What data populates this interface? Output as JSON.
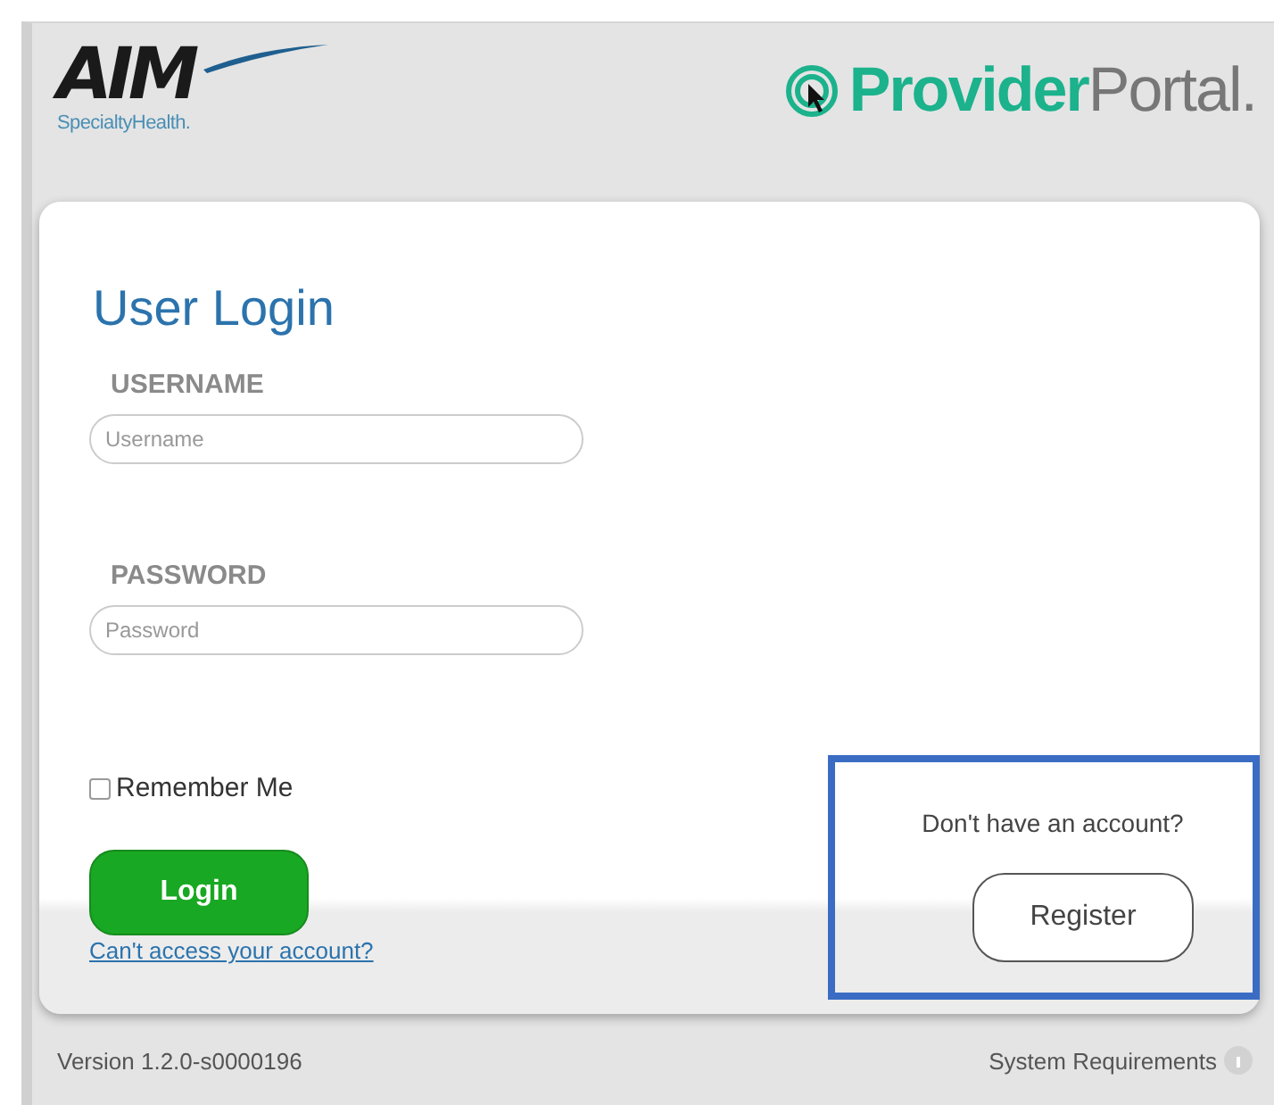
{
  "header": {
    "brand_logo": {
      "mark": "AIM",
      "tagline": "SpecialtyHealth."
    },
    "portal_logo": {
      "strong": "Provider",
      "light": "Portal."
    }
  },
  "login": {
    "title": "User Login",
    "fields": [
      {
        "label": "USERNAME",
        "placeholder": "Username"
      },
      {
        "label": "PASSWORD",
        "placeholder": "Password"
      }
    ],
    "remember": {
      "label": "Remember Me",
      "checked": false
    },
    "login_button": "Login",
    "help_link": "Can't access your account?"
  },
  "register_box": {
    "prompt": "Don't have an account?",
    "button": "Register",
    "highlighted": true
  },
  "footer": {
    "version": "Version 1.2.0-s0000196",
    "requirements_link": "System Requirements"
  }
}
